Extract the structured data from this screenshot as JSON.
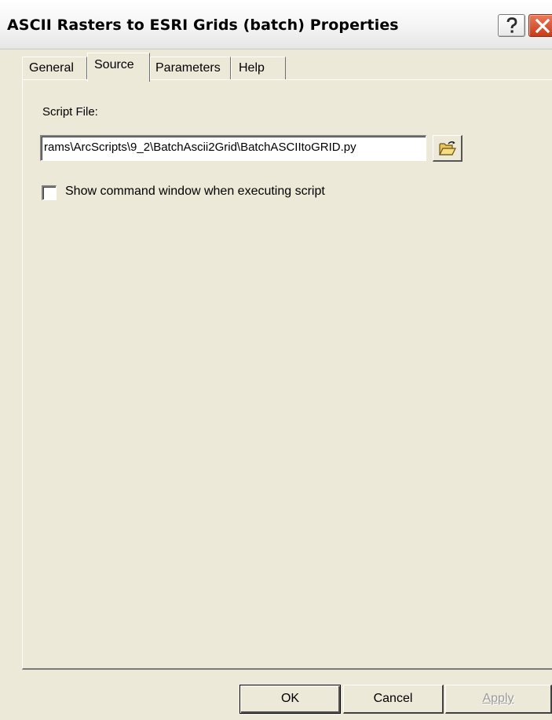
{
  "window": {
    "title": "ASCII Rasters to ESRI Grids (batch) Properties",
    "help_icon": "question-mark-icon",
    "close_icon": "close-x-icon"
  },
  "tabs": [
    {
      "label": "General",
      "selected": false
    },
    {
      "label": "Source",
      "selected": true
    },
    {
      "label": "Parameters",
      "selected": false
    },
    {
      "label": "Help",
      "selected": false
    }
  ],
  "source": {
    "script_file_label": "Script File:",
    "script_path": "rams\\ArcScripts\\9_2\\BatchAscii2Grid\\BatchASCIItoGRID.py",
    "browse_icon": "open-folder-icon",
    "show_command_window_label": "Show command window when executing script",
    "show_command_window_checked": false
  },
  "buttons": {
    "ok_label": "OK",
    "cancel_label": "Cancel",
    "apply_label": "Apply",
    "apply_enabled": false
  },
  "colors": {
    "dialog_face": "#ece9d8",
    "close_button": "#c73c1a"
  }
}
